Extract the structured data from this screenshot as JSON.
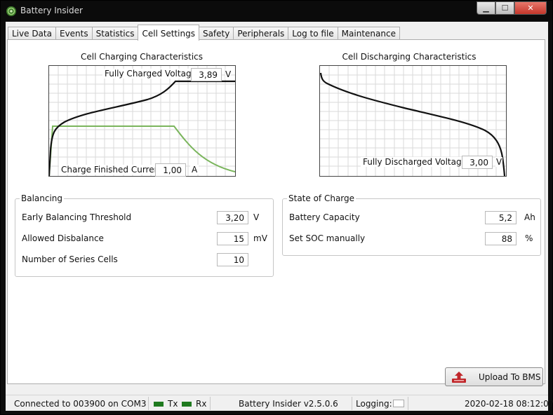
{
  "window": {
    "title": "Battery Insider",
    "controls": {
      "minimize": "▁",
      "maximize": "☐",
      "close": "✕"
    }
  },
  "tabs": [
    {
      "label": "Live Data",
      "active": false
    },
    {
      "label": "Events",
      "active": false
    },
    {
      "label": "Statistics",
      "active": false
    },
    {
      "label": "Cell Settings",
      "active": true
    },
    {
      "label": "Safety",
      "active": false
    },
    {
      "label": "Peripherals",
      "active": false
    },
    {
      "label": "Log to file",
      "active": false
    },
    {
      "label": "Maintenance",
      "active": false
    }
  ],
  "charging_chart": {
    "title": "Cell Charging Characteristics",
    "voltage_label": "Fully Charged Voltage",
    "voltage_value": "3,89",
    "voltage_unit": "V",
    "current_label": "Charge Finished Current",
    "current_value": "1,00",
    "current_unit": "A"
  },
  "discharging_chart": {
    "title": "Cell Discharging Characteristics",
    "voltage_label": "Fully Discharged Voltage",
    "voltage_value": "3,00",
    "voltage_unit": "V"
  },
  "balancing": {
    "legend": "Balancing",
    "early_label": "Early Balancing Threshold",
    "early_value": "3,20",
    "early_unit": "V",
    "disbalance_label": "Allowed Disbalance",
    "disbalance_value": "15",
    "disbalance_unit": "mV",
    "cells_label": "Number of Series Cells",
    "cells_value": "10"
  },
  "soc": {
    "legend": "State of Charge",
    "capacity_label": "Battery Capacity",
    "capacity_value": "5,2",
    "capacity_unit": "Ah",
    "manual_label": "Set SOC manually",
    "manual_value": "88",
    "manual_unit": "%"
  },
  "upload_button": {
    "label": "Upload To BMS",
    "icon": "upload-icon"
  },
  "status": {
    "connection": "Connected to 003900 on COM3",
    "tx": "Tx",
    "rx": "Rx",
    "version": "Battery Insider v2.5.0.6",
    "logging": "Logging:",
    "datetime": "2020-02-18 08:12:07"
  },
  "colors": {
    "voltage_curve": "#111111",
    "current_curve": "#7ab55c",
    "led": "#1f7a1f",
    "grid": "#d9d9d9"
  }
}
